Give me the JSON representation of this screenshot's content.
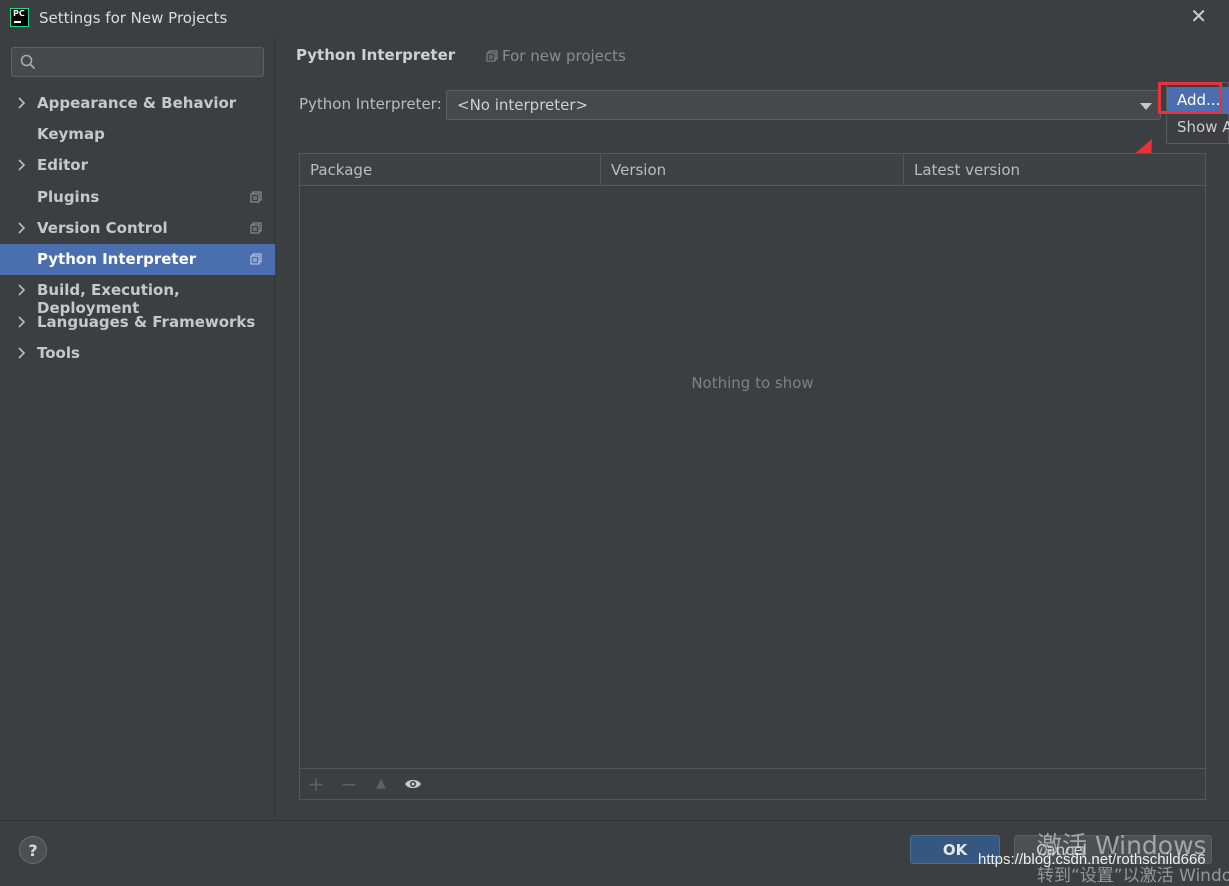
{
  "window": {
    "title": "Settings for New Projects",
    "logo_text": "PC"
  },
  "sidebar": {
    "search_placeholder": "",
    "items": [
      {
        "label": "Appearance & Behavior",
        "expandable": true,
        "project_icon": false,
        "selected": false
      },
      {
        "label": "Keymap",
        "expandable": false,
        "project_icon": false,
        "selected": false
      },
      {
        "label": "Editor",
        "expandable": true,
        "project_icon": false,
        "selected": false
      },
      {
        "label": "Plugins",
        "expandable": false,
        "project_icon": true,
        "selected": false
      },
      {
        "label": "Version Control",
        "expandable": true,
        "project_icon": true,
        "selected": false
      },
      {
        "label": "Python Interpreter",
        "expandable": false,
        "project_icon": true,
        "selected": true
      },
      {
        "label": "Build, Execution, Deployment",
        "expandable": true,
        "project_icon": false,
        "selected": false
      },
      {
        "label": "Languages & Frameworks",
        "expandable": true,
        "project_icon": false,
        "selected": false
      },
      {
        "label": "Tools",
        "expandable": true,
        "project_icon": false,
        "selected": false
      }
    ]
  },
  "main": {
    "title": "Python Interpreter",
    "scope_label": "For new projects",
    "interpreter_label": "Python Interpreter:",
    "interpreter_value": "<No interpreter>",
    "popup": {
      "add_label": "Add...",
      "show_all_label": "Show A"
    },
    "table": {
      "columns": [
        "Package",
        "Version",
        "Latest version"
      ],
      "empty_text": "Nothing to show",
      "toolbar": {
        "add": "+",
        "remove": "−",
        "upgrade": "▲"
      }
    }
  },
  "footer": {
    "help_label": "?",
    "ok_label": "OK",
    "cancel_label": "Cancel"
  },
  "watermark": {
    "activate": "激活 Windows",
    "goto": "转到“设置”以激活 Windows",
    "url": "https://blog.csdn.net/rothschild666"
  },
  "colors": {
    "background": "#3c3f41",
    "selection": "#4b6eaf",
    "ok_button": "#365880",
    "annotation_red": "#e8323c"
  }
}
